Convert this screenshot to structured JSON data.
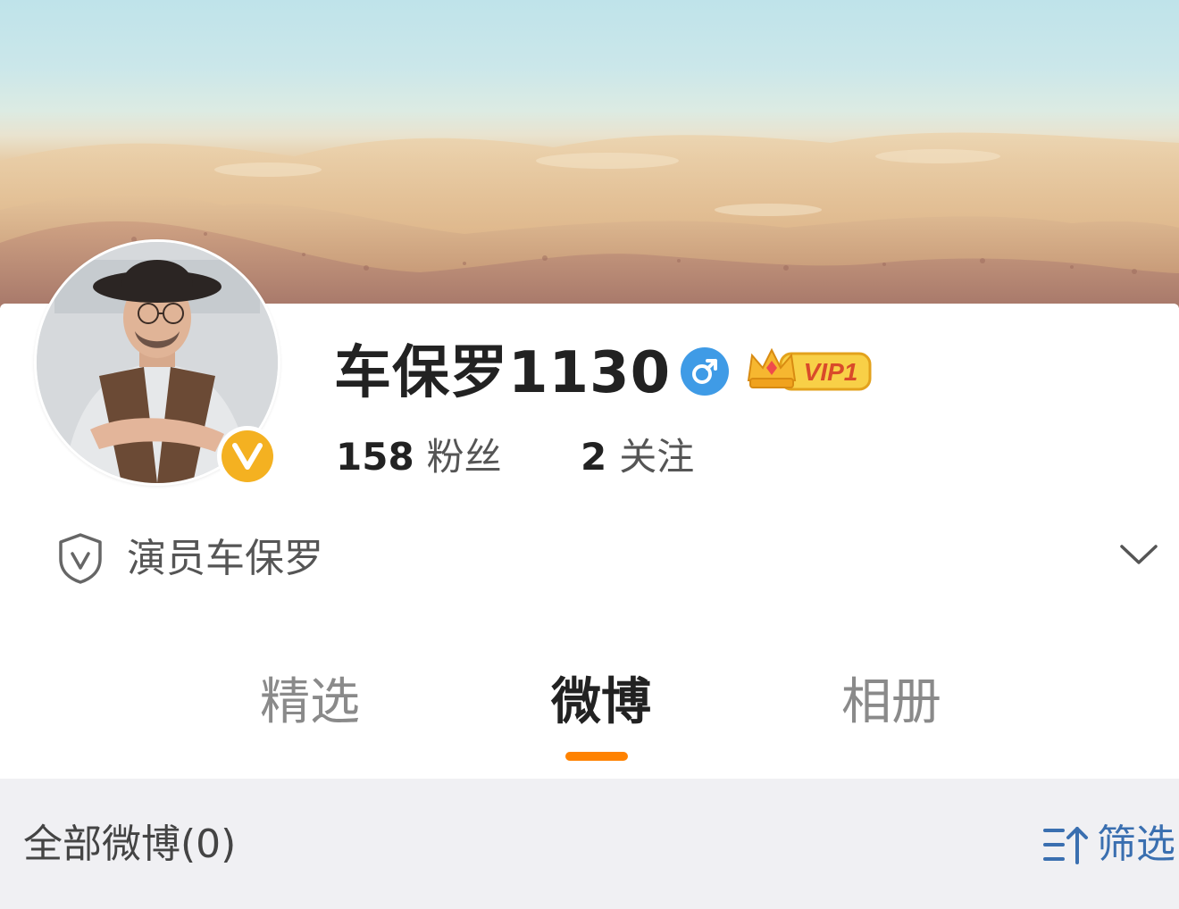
{
  "profile": {
    "name": "车保罗1130",
    "gender_icon": "male-symbol-icon",
    "vip_label": "VIP1",
    "verified_badge_letter": "V",
    "stats": {
      "fans_count": "158",
      "fans_label": "粉丝",
      "following_count": "2",
      "following_label": "关注"
    },
    "verification_text": "演员车保罗"
  },
  "tabs": [
    {
      "label": "精选",
      "active": false
    },
    {
      "label": "微博",
      "active": true
    },
    {
      "label": "相册",
      "active": false
    }
  ],
  "filter_bar": {
    "title": "全部微博(0)",
    "filter_label": "筛选"
  },
  "colors": {
    "accent_orange": "#ff8200",
    "verified_gold": "#f4b121",
    "gender_blue": "#3f9be6",
    "link_blue": "#3a6fb0",
    "vip_gold": "#f6c443"
  }
}
